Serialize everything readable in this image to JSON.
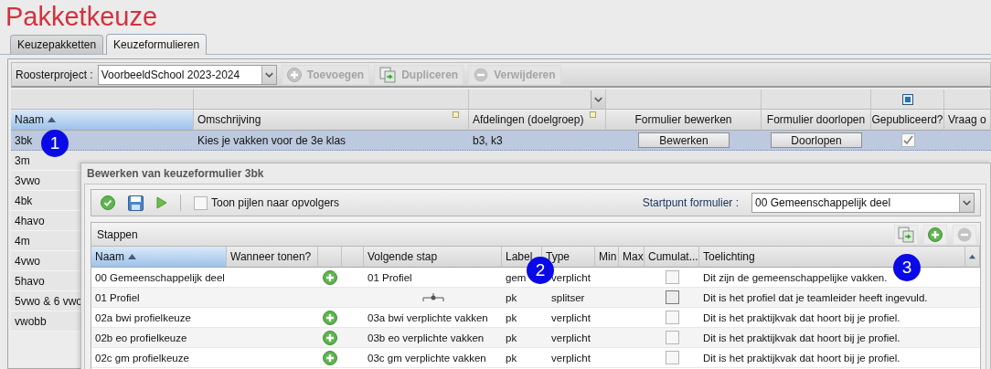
{
  "page_title": "Pakketkeuze",
  "tabs": [
    {
      "label": "Keuzepakketten",
      "selected": false
    },
    {
      "label": "Keuzeformulieren",
      "selected": true
    }
  ],
  "toolbar": {
    "project_label": "Roosterproject :",
    "project_value": "VoorbeeldSchool 2023-2024",
    "buttons": [
      {
        "label": "Toevoegen",
        "kind": "add",
        "disabled": true
      },
      {
        "label": "Dupliceren",
        "kind": "duplicate",
        "disabled": true
      },
      {
        "label": "Verwijderen",
        "kind": "remove",
        "disabled": true
      }
    ]
  },
  "forms_table": {
    "columns": [
      {
        "label": "Naam",
        "sorted": true
      },
      {
        "label": "Omschrijving",
        "sorted": false
      },
      {
        "label": "Afdelingen (doelgroep)",
        "sorted": false
      },
      {
        "label": "Formulier bewerken",
        "sorted": false
      },
      {
        "label": "Formulier doorlopen",
        "sorted": false
      },
      {
        "label": "Gepubliceerd?",
        "sorted": false
      },
      {
        "label": "Vraag o",
        "sorted": false
      }
    ],
    "published_filter": {
      "checked": true
    },
    "rows": [
      {
        "naam": "3bk",
        "omschrijving": "Kies je vakken voor de 3e klas",
        "afdelingen": "b3, k3",
        "is_template": false,
        "edit_button": "Bewerken",
        "run_button": "Doorlopen",
        "published": true,
        "selected": true
      },
      {
        "naam": "3m",
        "selected": false
      },
      {
        "naam": "3vwo",
        "selected": false
      },
      {
        "naam": "4bk",
        "selected": false
      },
      {
        "naam": "4havo",
        "selected": false
      },
      {
        "naam": "4m",
        "selected": false
      },
      {
        "naam": "4vwo",
        "selected": false
      },
      {
        "naam": "5havo",
        "selected": false
      },
      {
        "naam": "5vwo & 6 vwo",
        "selected": false
      },
      {
        "naam": "vwobb",
        "selected": false
      }
    ]
  },
  "dialog": {
    "title": "Bewerken van keuzeformulier 3bk",
    "arrows_checkbox": {
      "label": "Toon pijlen naar opvolgers",
      "checked": false
    },
    "start_label": "Startpunt formulier :",
    "start_value": "00 Gemeenschappelijk deel",
    "steps": {
      "title": "Stappen",
      "columns": [
        {
          "label": "Naam",
          "sorted": true
        },
        {
          "label": "Wanneer tonen?",
          "sorted": false
        },
        {
          "sorted": false
        },
        {
          "sorted": false
        },
        {
          "label": "Volgende stap",
          "sorted": false
        },
        {
          "label": "Label",
          "sorted": false
        },
        {
          "label": "Type",
          "sorted": false
        },
        {
          "label": "Min",
          "sorted": false
        },
        {
          "label": "Max",
          "sorted": false
        },
        {
          "label": "Cumulat...",
          "sorted": false
        },
        {
          "label": "Toelichting",
          "sorted": false
        }
      ],
      "rows": [
        {
          "naam": "00 Gemeenschappelijk deel",
          "kind": "add",
          "volgende": "01 Profiel",
          "label": "gem",
          "type": "verplicht",
          "cumulatief": false,
          "toelichting": "Dit zijn de gemeenschappelijke vakken."
        },
        {
          "naam": "01 Profiel",
          "kind": "splitter",
          "label": "pk",
          "type": "splitser",
          "cumulatief": false,
          "toelichting": "Dit is het profiel dat je teamleider heeft ingevuld."
        },
        {
          "naam": "02a bwi profielkeuze",
          "kind": "add",
          "volgende": "03a bwi verplichte vakken",
          "label": "pk",
          "type": "verplicht",
          "cumulatief": false,
          "toelichting": "Dit is het praktijkvak dat hoort bij je profiel."
        },
        {
          "naam": "02b eo profielkeuze",
          "kind": "add",
          "volgende": "03b eo verplichte vakken",
          "label": "pk",
          "type": "verplicht",
          "cumulatief": false,
          "toelichting": "Dit is het praktijkvak dat hoort bij je profiel."
        },
        {
          "naam": "02c gm profielkeuze",
          "kind": "add",
          "volgende": "03c gm verplichte vakken",
          "label": "pk",
          "type": "verplicht",
          "cumulatief": false,
          "toelichting": "Dit is het praktijkvak dat hoort bij je profiel."
        }
      ]
    }
  },
  "markers": [
    {
      "label": "1"
    },
    {
      "label": "2"
    },
    {
      "label": "3"
    }
  ]
}
